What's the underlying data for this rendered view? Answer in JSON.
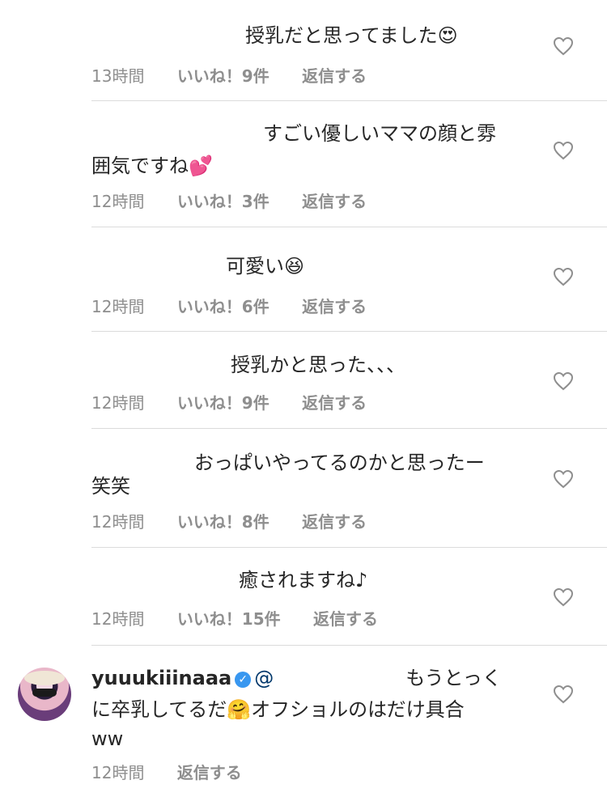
{
  "comments": [
    {
      "text": "授乳だと思ってました😍",
      "time": "13時間",
      "likes": "いいね！9件",
      "reply": "返信する"
    },
    {
      "text_line1": "すごい優しいママの顔と雰",
      "text_line2": "囲気ですね💕",
      "time": "12時間",
      "likes": "いいね！3件",
      "reply": "返信する"
    },
    {
      "text": "可愛い😆",
      "time": "12時間",
      "likes": "いいね！6件",
      "reply": "返信する"
    },
    {
      "text": "授乳かと思った、、、",
      "time": "12時間",
      "likes": "いいね！9件",
      "reply": "返信する"
    },
    {
      "text_line1": "おっぱいやってるのかと思ったー",
      "text_line2": "笑笑",
      "time": "12時間",
      "likes": "いいね！8件",
      "reply": "返信する"
    },
    {
      "text": "癒されますね♪",
      "time": "12時間",
      "likes": "いいね！15件",
      "reply": "返信する"
    },
    {
      "username": "yuuukiiinaaa",
      "verified_mark": "✓",
      "mention": "@",
      "text_line1": "もうとっく",
      "text_line2": "に卒乳してるだ🤗オフショルのはだけ具合",
      "text_line3": "ww",
      "time": "12時間",
      "reply": "返信する"
    }
  ],
  "icons": {
    "like": "heart-outline-icon",
    "verified": "verified-badge-icon"
  },
  "colors": {
    "text": "#262626",
    "meta": "#8e8e8e",
    "divider": "#dbdbdb",
    "verified": "#3897f0",
    "mention": "#00376b"
  }
}
